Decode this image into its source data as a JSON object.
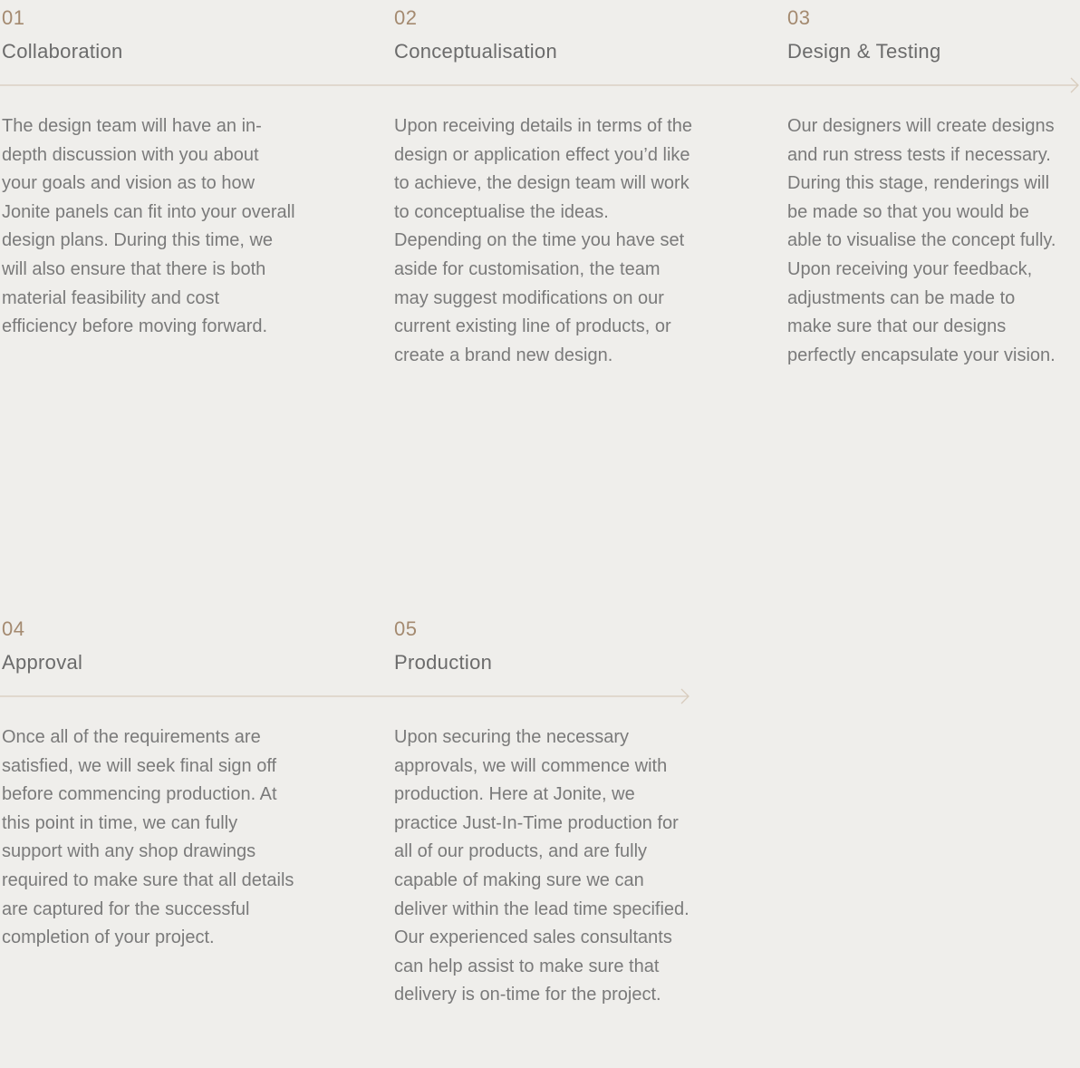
{
  "colors": {
    "background": "#efeeeb",
    "accent_number": "#a48a70",
    "title": "#6b6b6b",
    "body": "#7a7a7a",
    "timeline_line": "#d8ccbd"
  },
  "steps": [
    {
      "number": "01",
      "title": "Collaboration",
      "description": "The design team will have an in-depth discussion with you about your goals and vision as to how Jonite panels can fit into your overall design plans. During this time, we will also ensure that there is both material feasibility and cost efficiency before moving forward."
    },
    {
      "number": "02",
      "title": "Conceptualisation",
      "description": "Upon receiving details in terms of the design or application effect you’d like to achieve, the design team will work to conceptualise the ideas. Depending on the time you have set aside for customisation, the team may suggest modifications on our current existing line of products, or create a brand new design."
    },
    {
      "number": "03",
      "title": "Design & Testing",
      "description": "Our designers will create designs and run stress tests if necessary. During this stage, renderings will be made so that you would be able to visualise the concept fully. Upon receiving your feedback, adjustments can be made to make sure that our designs perfectly encapsulate your vision."
    },
    {
      "number": "04",
      "title": "Approval",
      "description": "Once all of the requirements are satisfied, we will seek final sign off before commencing production. At this point in time, we can fully support with any shop drawings required to make sure that all details are captured for the successful completion of your project."
    },
    {
      "number": "05",
      "title": "Production",
      "description": "Upon securing the necessary approvals, we will commence with production. Here at Jonite, we practice Just-In-Time production for all of our products, and are fully capable of making sure we can deliver within the lead time specified. Our experienced sales consultants can help assist to make sure that delivery is on-time for the project."
    }
  ]
}
